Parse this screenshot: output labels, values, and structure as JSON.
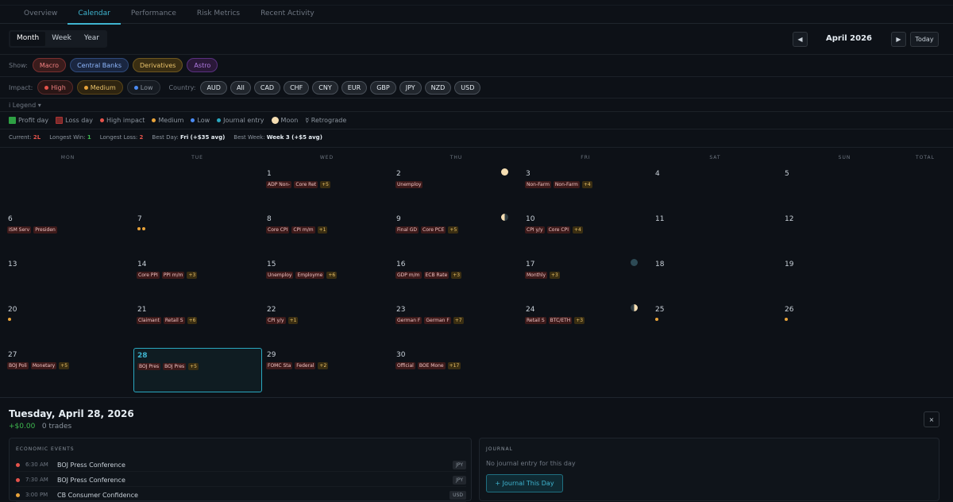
{
  "tabs": [
    "Overview",
    "Calendar",
    "Performance",
    "Risk Metrics",
    "Recent Activity"
  ],
  "view": {
    "modes": [
      "Month",
      "Week",
      "Year"
    ],
    "active": "Month"
  },
  "nav": {
    "prev_icon": "◀",
    "next_icon": "▶",
    "month_label": "April 2026",
    "today_label": "Today"
  },
  "show": {
    "label": "Show:",
    "filters": [
      {
        "label": "Macro",
        "color": "#f08080",
        "bg": "#3a1c1c",
        "border": "#7a3030"
      },
      {
        "label": "Central Banks",
        "color": "#8fb8ff",
        "bg": "#1a2640",
        "border": "#2f4a7a"
      },
      {
        "label": "Derivatives",
        "color": "#e8c26a",
        "bg": "#3a2e12",
        "border": "#6e5720"
      },
      {
        "label": "Astro",
        "color": "#b07ae0",
        "bg": "#2a1838",
        "border": "#5a3080"
      }
    ]
  },
  "impact": {
    "label": "Impact:",
    "items": [
      {
        "label": "High",
        "dot": "#e5534b",
        "color": "#f08080",
        "bg": "#2a1616",
        "border": "#5a2a2a"
      },
      {
        "label": "Medium",
        "dot": "#e8a33a",
        "color": "#e8c26a",
        "bg": "#2e2410",
        "border": "#5a4518"
      },
      {
        "label": "Low",
        "dot": "#4b8bf5",
        "color": "#8b949e",
        "bg": "#161b22",
        "border": "#30363d"
      }
    ]
  },
  "country": {
    "label": "Country:",
    "items": [
      "AUD",
      "All",
      "CAD",
      "CHF",
      "CNY",
      "EUR",
      "GBP",
      "JPY",
      "NZD",
      "USD"
    ]
  },
  "legend_toggle": "i Legend ▾",
  "legend": [
    {
      "type": "sq",
      "color": "#2ea043",
      "label": "Profit day"
    },
    {
      "type": "sq",
      "color": "#7a2a2a",
      "label": "Loss day"
    },
    {
      "type": "dot",
      "color": "#e5534b",
      "label": "High impact"
    },
    {
      "type": "dot",
      "color": "#e8a33a",
      "label": "Medium"
    },
    {
      "type": "dot",
      "color": "#4b8bf5",
      "label": "Low"
    },
    {
      "type": "dot",
      "color": "#2aa8c0",
      "label": "Journal entry"
    },
    {
      "type": "moon",
      "color": "#f5deb3",
      "label": "Moon"
    },
    {
      "type": "txt",
      "color": "#8b949e",
      "label": "☿ Retrograde"
    }
  ],
  "stats": {
    "current_label": "Current:",
    "current": "2L",
    "win_label": "Longest Win:",
    "win": "1",
    "loss_label": "Longest Loss:",
    "loss": "2",
    "bestday_label": "Best Day:",
    "bestday": "Fri (+$35 avg)",
    "bestweek_label": "Best Week:",
    "bestweek": "Week 3 (+$5 avg)"
  },
  "day_headers": [
    "MON",
    "TUE",
    "WED",
    "THU",
    "FRI",
    "SAT",
    "SUN"
  ],
  "total_header": "TOTAL",
  "days": [
    {
      "d": "1",
      "col": 2,
      "row": 0,
      "tags": [
        "ADP Non-",
        "Core Ret"
      ],
      "more": "+5"
    },
    {
      "d": "2",
      "col": 3,
      "row": 0,
      "tags": [
        "Unemploy"
      ],
      "more": ""
    },
    {
      "d": "3",
      "col": 4,
      "row": 0,
      "tags": [
        "Non-Farm",
        "Non-Farm"
      ],
      "more": "+4"
    },
    {
      "d": "4",
      "col": 5,
      "row": 0,
      "tags": [],
      "more": ""
    },
    {
      "d": "5",
      "col": 6,
      "row": 0,
      "tags": [],
      "more": ""
    },
    {
      "d": "6",
      "col": 0,
      "row": 1,
      "tags": [
        "ISM Serv",
        "Presiden"
      ],
      "more": ""
    },
    {
      "d": "7",
      "col": 1,
      "row": 1,
      "tags": [],
      "more": "",
      "dots": 2
    },
    {
      "d": "8",
      "col": 2,
      "row": 1,
      "tags": [
        "Core CPI",
        "CPI m/m"
      ],
      "more": "+1"
    },
    {
      "d": "9",
      "col": 3,
      "row": 1,
      "tags": [
        "Final GD",
        "Core PCE"
      ],
      "more": "+5"
    },
    {
      "d": "10",
      "col": 4,
      "row": 1,
      "tags": [
        "CPI y/y",
        "Core CPI"
      ],
      "more": "+4"
    },
    {
      "d": "11",
      "col": 5,
      "row": 1,
      "tags": [],
      "more": ""
    },
    {
      "d": "12",
      "col": 6,
      "row": 1,
      "tags": [],
      "more": ""
    },
    {
      "d": "13",
      "col": 0,
      "row": 2,
      "tags": [],
      "more": ""
    },
    {
      "d": "14",
      "col": 1,
      "row": 2,
      "tags": [
        "Core PPI",
        "PPI m/m"
      ],
      "more": "+3"
    },
    {
      "d": "15",
      "col": 2,
      "row": 2,
      "tags": [
        "Unemploy",
        "Employme"
      ],
      "more": "+6"
    },
    {
      "d": "16",
      "col": 3,
      "row": 2,
      "tags": [
        "GDP m/m",
        "ECB Rate"
      ],
      "more": "+3"
    },
    {
      "d": "17",
      "col": 4,
      "row": 2,
      "tags": [
        "Monthly"
      ],
      "more": "+3"
    },
    {
      "d": "18",
      "col": 5,
      "row": 2,
      "tags": [],
      "more": ""
    },
    {
      "d": "19",
      "col": 6,
      "row": 2,
      "tags": [],
      "more": ""
    },
    {
      "d": "20",
      "col": 0,
      "row": 3,
      "tags": [],
      "more": "",
      "dots": 1
    },
    {
      "d": "21",
      "col": 1,
      "row": 3,
      "tags": [
        "Claimant",
        "Retail S"
      ],
      "more": "+6"
    },
    {
      "d": "22",
      "col": 2,
      "row": 3,
      "tags": [
        "CPI y/y"
      ],
      "more": "+1"
    },
    {
      "d": "23",
      "col": 3,
      "row": 3,
      "tags": [
        "German F",
        "German F"
      ],
      "more": "+7"
    },
    {
      "d": "24",
      "col": 4,
      "row": 3,
      "tags": [
        "Retail S",
        "BTC/ETH"
      ],
      "more": "+3"
    },
    {
      "d": "25",
      "col": 5,
      "row": 3,
      "tags": [],
      "more": "",
      "dots": 1
    },
    {
      "d": "26",
      "col": 6,
      "row": 3,
      "tags": [],
      "more": "",
      "dots": 1
    },
    {
      "d": "27",
      "col": 0,
      "row": 4,
      "tags": [
        "BOJ Poli",
        "Monetary"
      ],
      "more": "+5"
    },
    {
      "d": "28",
      "col": 1,
      "row": 4,
      "tags": [
        "BOJ Pres",
        "BOJ Pres"
      ],
      "more": "+5",
      "today": true
    },
    {
      "d": "29",
      "col": 2,
      "row": 4,
      "tags": [
        "FOMC Sta",
        "Federal"
      ],
      "more": "+2"
    },
    {
      "d": "30",
      "col": 3,
      "row": 4,
      "tags": [
        "Official",
        "BOE Mone"
      ],
      "more": "+17"
    }
  ],
  "moons": [
    {
      "col": 3,
      "row": 0,
      "phase": "full"
    },
    {
      "col": 3,
      "row": 1,
      "phase": "last-quarter"
    },
    {
      "col": 4,
      "row": 2,
      "phase": "new"
    },
    {
      "col": 4,
      "row": 3,
      "phase": "first-quarter"
    }
  ],
  "detail": {
    "title": "Tuesday, April 28, 2026",
    "pnl": "+$0.00",
    "trades": "0 trades",
    "close_icon": "×",
    "events_title": "ECONOMIC EVENTS",
    "events": [
      {
        "time": "6:30 AM",
        "name": "BOJ Press Conference",
        "cur": "JPY",
        "color": "#e5534b"
      },
      {
        "time": "7:30 AM",
        "name": "BOJ Press Conference",
        "cur": "JPY",
        "color": "#e5534b"
      },
      {
        "time": "3:00 PM",
        "name": "CB Consumer Confidence",
        "cur": "USD",
        "color": "#e8a33a"
      }
    ],
    "journal_title": "JOURNAL",
    "journal_empty": "No journal entry for this day",
    "journal_button": "+ Journal This Day"
  }
}
